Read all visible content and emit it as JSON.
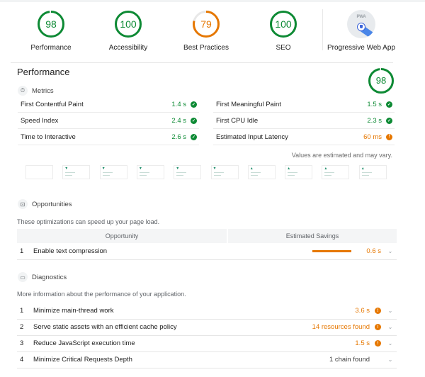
{
  "colors": {
    "pass": "#0d8a34",
    "average": "#e67700",
    "pwa_blue": "#4a86e8"
  },
  "categories": [
    {
      "name": "Performance",
      "score": 98,
      "fraction": 0.98,
      "status": "pass"
    },
    {
      "name": "Accessibility",
      "score": 100,
      "fraction": 1.0,
      "status": "pass"
    },
    {
      "name": "Best Practices",
      "score": 79,
      "fraction": 0.79,
      "status": "average"
    },
    {
      "name": "SEO",
      "score": 100,
      "fraction": 1.0,
      "status": "pass"
    }
  ],
  "pwa": {
    "name": "Progressive Web App",
    "badge_text": "PWA",
    "icon": "pwa-badge-icon"
  },
  "performance": {
    "title": "Performance",
    "score": 98,
    "fraction": 0.98,
    "metrics_heading": "Metrics",
    "metrics_icon": "stopwatch-icon",
    "metrics_left": [
      {
        "label": "First Contentful Paint",
        "value": "1.4 s",
        "status": "pass"
      },
      {
        "label": "Speed Index",
        "value": "2.4 s",
        "status": "pass"
      },
      {
        "label": "Time to Interactive",
        "value": "2.6 s",
        "status": "pass"
      }
    ],
    "metrics_right": [
      {
        "label": "First Meaningful Paint",
        "value": "1.5 s",
        "status": "pass"
      },
      {
        "label": "First CPU Idle",
        "value": "2.3 s",
        "status": "pass"
      },
      {
        "label": "Estimated Input Latency",
        "value": "60 ms",
        "status": "average"
      }
    ],
    "estimated_note": "Values are estimated and may vary.",
    "filmstrip_frames": 10
  },
  "opportunities": {
    "heading": "Opportunities",
    "icon": "opportunity-icon",
    "description": "These optimizations can speed up your page load.",
    "col_opportunity": "Opportunity",
    "col_savings": "Estimated Savings",
    "items": [
      {
        "num": "1",
        "title": "Enable text compression",
        "value": "0.6 s",
        "status": "average"
      }
    ]
  },
  "diagnostics": {
    "heading": "Diagnostics",
    "icon": "clipboard-icon",
    "description": "More information about the performance of your application.",
    "items": [
      {
        "num": "1",
        "title": "Minimize main-thread work",
        "value": "3.6 s",
        "status": "average"
      },
      {
        "num": "2",
        "title": "Serve static assets with an efficient cache policy",
        "value": "14 resources found",
        "status": "average"
      },
      {
        "num": "3",
        "title": "Reduce JavaScript execution time",
        "value": "1.5 s",
        "status": "average"
      },
      {
        "num": "4",
        "title": "Minimize Critical Requests Depth",
        "value": "1 chain found",
        "status": "neutral"
      }
    ]
  },
  "icons": {
    "chevron": "⌄",
    "check": "✓",
    "info": "!"
  }
}
